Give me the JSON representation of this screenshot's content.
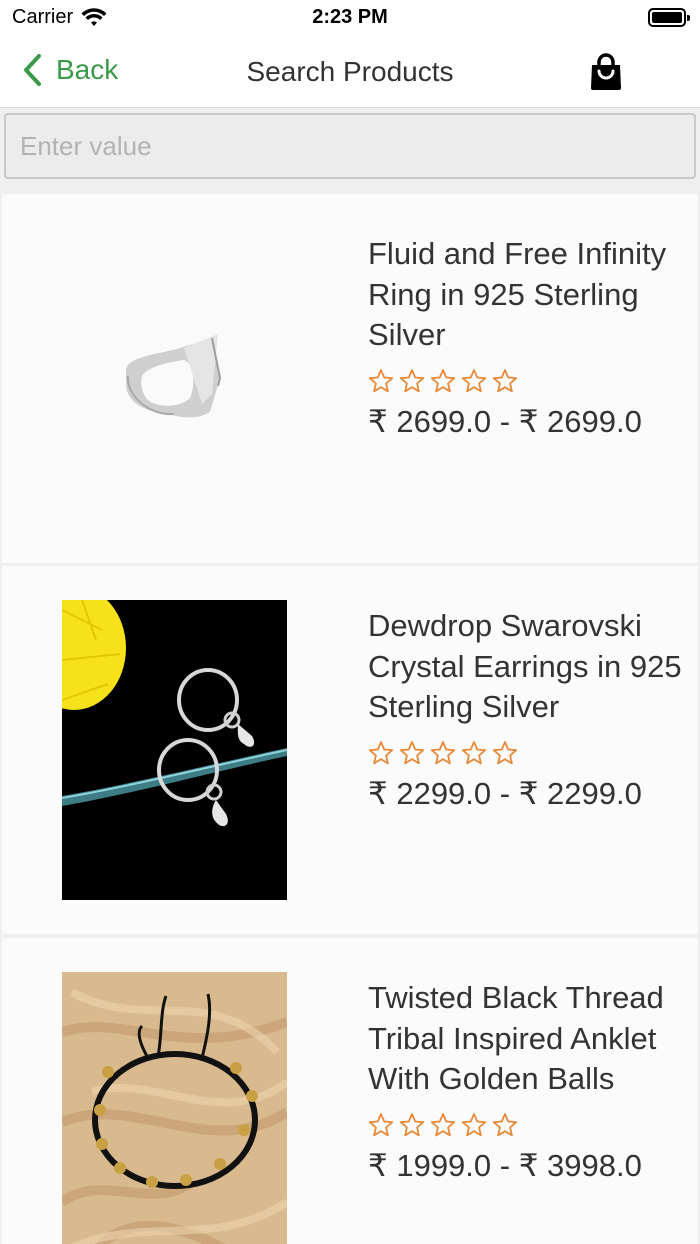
{
  "status_bar": {
    "carrier": "Carrier",
    "time": "2:23 PM"
  },
  "nav": {
    "back_label": "Back",
    "title": "Search Products"
  },
  "search": {
    "placeholder": "Enter value",
    "value": ""
  },
  "colors": {
    "accent_green": "#3a9a4a",
    "star_orange": "#e8893a"
  },
  "products": [
    {
      "title": "Fluid and Free Infinity Ring in 925 Sterling Silver",
      "rating": 0,
      "price": "₹ 2699.0 - ₹ 2699.0",
      "image": "silver-ring-image"
    },
    {
      "title": "Dewdrop Swarovski Crystal Earrings in 925 Sterling Silver",
      "rating": 0,
      "price": "₹ 2299.0 - ₹ 2299.0",
      "image": "crystal-earrings-image"
    },
    {
      "title": "Twisted Black Thread Tribal Inspired Anklet With Golden Balls",
      "rating": 0,
      "price": "₹ 1999.0 - ₹ 3998.0",
      "image": "black-thread-anklet-image"
    }
  ]
}
